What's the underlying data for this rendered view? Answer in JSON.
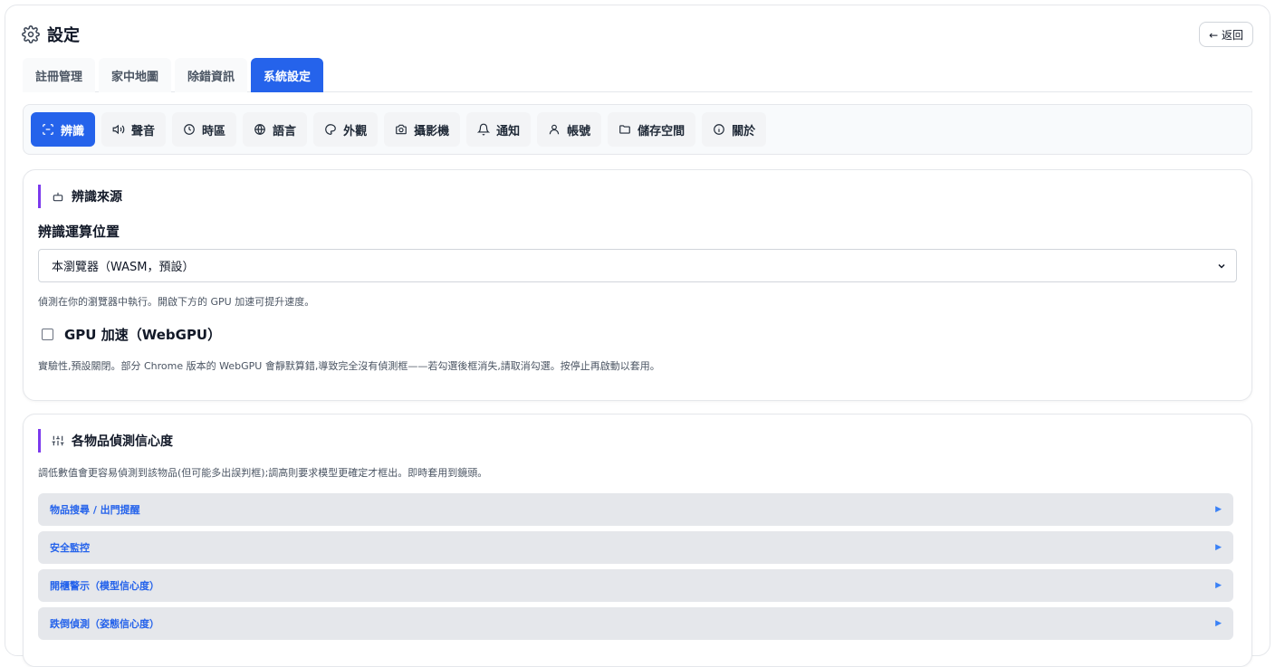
{
  "header": {
    "title": "設定",
    "back_label": "← 返回"
  },
  "main_tabs": [
    {
      "label": "註冊管理",
      "active": false
    },
    {
      "label": "家中地圖",
      "active": false
    },
    {
      "label": "除錯資訊",
      "active": false
    },
    {
      "label": "系統設定",
      "active": true
    }
  ],
  "sub_tabs": [
    {
      "label": "辨識",
      "icon": "scan-icon",
      "active": true
    },
    {
      "label": "聲音",
      "icon": "speaker-icon",
      "active": false
    },
    {
      "label": "時區",
      "icon": "clock-icon",
      "active": false
    },
    {
      "label": "語言",
      "icon": "globe-icon",
      "active": false
    },
    {
      "label": "外觀",
      "icon": "palette-icon",
      "active": false
    },
    {
      "label": "攝影機",
      "icon": "camera-icon",
      "active": false
    },
    {
      "label": "通知",
      "icon": "bell-icon",
      "active": false
    },
    {
      "label": "帳號",
      "icon": "user-icon",
      "active": false
    },
    {
      "label": "儲存空間",
      "icon": "folder-icon",
      "active": false
    },
    {
      "label": "關於",
      "icon": "info-icon",
      "active": false
    }
  ],
  "recognition_source": {
    "title": "辨識來源",
    "field_label": "辨識運算位置",
    "select_value": "本瀏覽器（WASM，預設）",
    "select_hint": "偵測在你的瀏覽器中執行。開啟下方的 GPU 加速可提升速度。",
    "gpu_label": "GPU 加速（WebGPU）",
    "gpu_checked": false,
    "gpu_hint": "實驗性,預設關閉。部分 Chrome 版本的 WebGPU 會靜默算錯,導致完全沒有偵測框——若勾選後框消失,請取消勾選。按停止再啟動以套用。"
  },
  "confidence": {
    "title": "各物品偵測信心度",
    "hint": "調低數值會更容易偵測到該物品(但可能多出誤判框);調高則要求模型更確定才框出。即時套用到鏡頭。",
    "groups": [
      {
        "label": "物品搜尋 / 出門提醒"
      },
      {
        "label": "安全監控"
      },
      {
        "label": "開櫃警示（模型信心度）"
      },
      {
        "label": "跌倒偵測（姿態信心度）"
      }
    ]
  },
  "colors": {
    "accent": "#2563eb",
    "section_bar": "#7c3aed"
  }
}
